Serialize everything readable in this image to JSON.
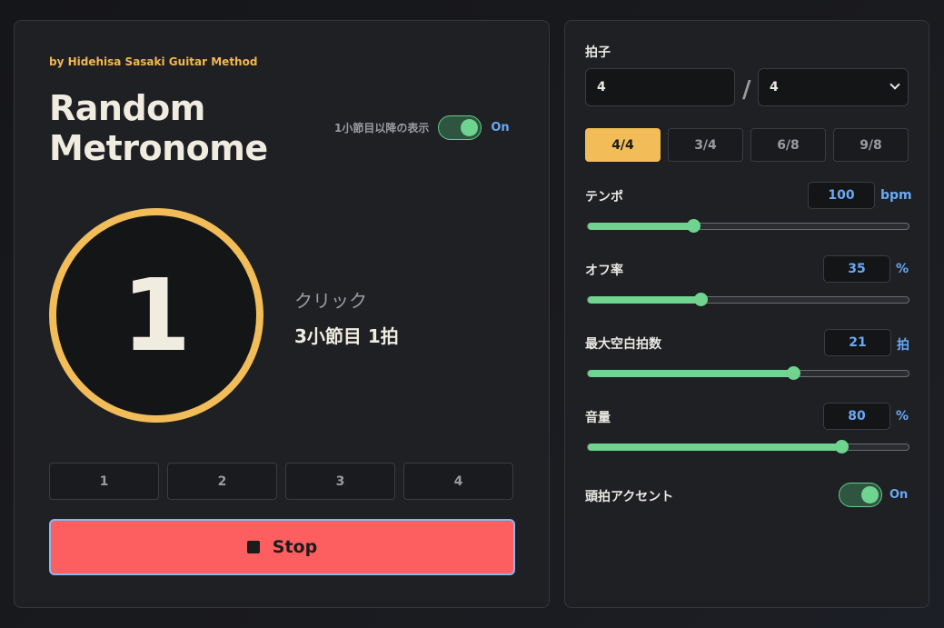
{
  "header": {
    "byline": "by Hidehisa Sasaki Guitar Method",
    "title_line1": "Random",
    "title_line2": "Metronome"
  },
  "display_toggle": {
    "label": "1小節目以降の表示",
    "state": "On"
  },
  "beat_display": {
    "number": "1",
    "kind": "クリック",
    "position": "3小節目 1拍"
  },
  "beat_cells": [
    "1",
    "2",
    "3",
    "4"
  ],
  "stop_button": {
    "label": "Stop"
  },
  "time_signature": {
    "label": "拍子",
    "numerator": "4",
    "separator": "/",
    "denominator": "4",
    "presets": [
      "4/4",
      "3/4",
      "6/8",
      "9/8"
    ],
    "active_preset": "4/4"
  },
  "tempo": {
    "label": "テンポ",
    "value": "100",
    "unit": "bpm",
    "fraction": 0.33
  },
  "off_rate": {
    "label": "オフ率",
    "value": "35",
    "unit": "%",
    "fraction": 0.35
  },
  "max_rest": {
    "label": "最大空白拍数",
    "value": "21",
    "unit": "拍",
    "fraction": 0.64
  },
  "volume": {
    "label": "音量",
    "value": "80",
    "unit": "%",
    "fraction": 0.79
  },
  "accent": {
    "label": "頭拍アクセント",
    "state": "On"
  },
  "colors": {
    "accent": "#f2bd58",
    "stop": "#fd5f61",
    "toggle_on": "#6ed48f",
    "value_text": "#6aa8f5"
  }
}
